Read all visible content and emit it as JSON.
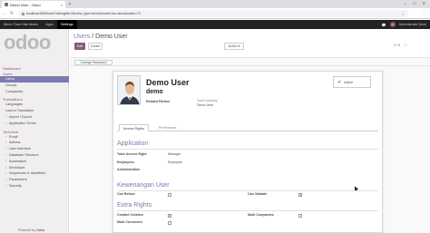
{
  "browser": {
    "tab_title": "Demo User - Odoo",
    "tab_close": "×",
    "new_tab": "+",
    "window_controls": "– ☐ ✕",
    "url": "localhost:8069/web?debug#id=5&view_type=form&model=res.users&action=71",
    "star": "☆",
    "menu_dots": "⋮"
  },
  "topbar": {
    "menus": [
      "Menu Tutor Hak Akses",
      "Apps",
      "Settings"
    ],
    "active_menu": "Settings",
    "chat_icon": "💬",
    "user": "Administrator (test)"
  },
  "sidebar": {
    "logo": "odoo",
    "groups": [
      {
        "title": "Dashboard",
        "items": []
      },
      {
        "title": "Users",
        "items": [
          "Users",
          "Groups",
          "Companies"
        ]
      },
      {
        "title": "Translations",
        "items": [
          "Languages",
          "Load a Translation",
          "Import / Export",
          "Application Terms"
        ]
      },
      {
        "title": "Technical",
        "items": [
          "Email",
          "Actions",
          "User Interface",
          "Database Structure",
          "Automation",
          "Workflows",
          "Sequences & Identifiers",
          "Parameters",
          "Security"
        ]
      }
    ],
    "active_item": "Users",
    "powered_by": "Powered by",
    "powered_brand": "Odoo"
  },
  "control_panel": {
    "breadcrumb_parent": "Users",
    "breadcrumb_sep": "/",
    "breadcrumb_current": "Demo User",
    "edit_label": "Edit",
    "create_label": "Create",
    "action_label": "Action ▾",
    "pager": "2 / 9",
    "pager_arrows": "‹ ›"
  },
  "statusbar": {
    "change_password_label": "Change Password"
  },
  "form": {
    "name": "Demo User",
    "login": "demo",
    "active_label": "Active",
    "related_partner_label": "Related Partner",
    "related_partner_company": "YourCompany",
    "related_partner_name": "Demo User",
    "tabs": [
      "Access Rights",
      "Preferences"
    ],
    "active_tab": "Access Rights",
    "application": {
      "title": "Application",
      "fields": [
        {
          "label": "Tutor Access Right",
          "value": "Manager"
        },
        {
          "label": "Employees",
          "value": "Employee"
        },
        {
          "label": "Administration",
          "value": ""
        }
      ]
    },
    "kewenangan": {
      "title": "Kewenangan User",
      "left": {
        "label": "Can Refuse",
        "checked": false
      },
      "right": {
        "label": "Can Validate",
        "checked": true
      }
    },
    "extra_rights": {
      "title": "Extra Rights",
      "left": [
        {
          "label": "Contact Creation",
          "checked": true
        },
        {
          "label": "Multi Currencies",
          "checked": false
        }
      ],
      "right": [
        {
          "label": "Multi Companies",
          "checked": false
        }
      ]
    }
  },
  "colors": {
    "brand": "#875a7b",
    "accent": "#7c7bad",
    "topbar": "#222222"
  }
}
